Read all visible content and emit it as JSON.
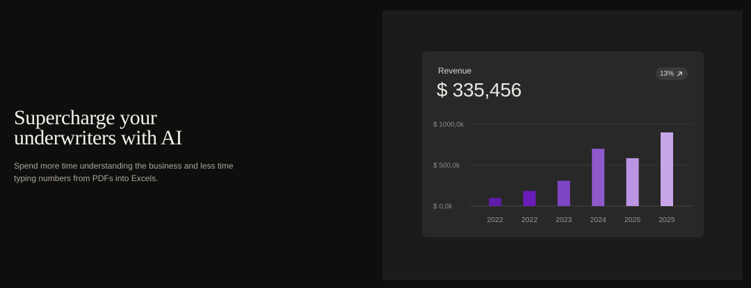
{
  "hero": {
    "title_line1": "Supercharge your",
    "title_line2": "underwriters with AI",
    "subtitle": "Spend more time understanding the business and less time typing numbers from PDFs into Excels."
  },
  "revenue_card": {
    "label": "Revenue",
    "value": "$ 335,456",
    "growth": "13%",
    "growth_icon": "arrow-up-right-icon"
  },
  "colors": {
    "page_bg": "#0f0e0d",
    "panel_bg": "#1b1b1b",
    "card_bg": "#282828",
    "bars": [
      "#5e1ba8",
      "#6a1db8",
      "#7f45c4",
      "#9059cc",
      "#bb95e3",
      "#c9a6ea"
    ]
  },
  "chart_data": {
    "type": "bar",
    "categories": [
      "2022",
      "2022",
      "2023",
      "2024",
      "2025",
      "2025"
    ],
    "values": [
      100,
      185,
      310,
      700,
      585,
      900
    ],
    "y_ticks": [
      {
        "value": 0,
        "label": "$ 0,0k"
      },
      {
        "value": 500,
        "label": "$ 500,0k"
      },
      {
        "value": 1000,
        "label": "$ 1000,0k"
      }
    ],
    "ylim": [
      0,
      1000
    ],
    "grid": true,
    "legend": "none",
    "title": "",
    "xlabel": "",
    "ylabel": ""
  }
}
